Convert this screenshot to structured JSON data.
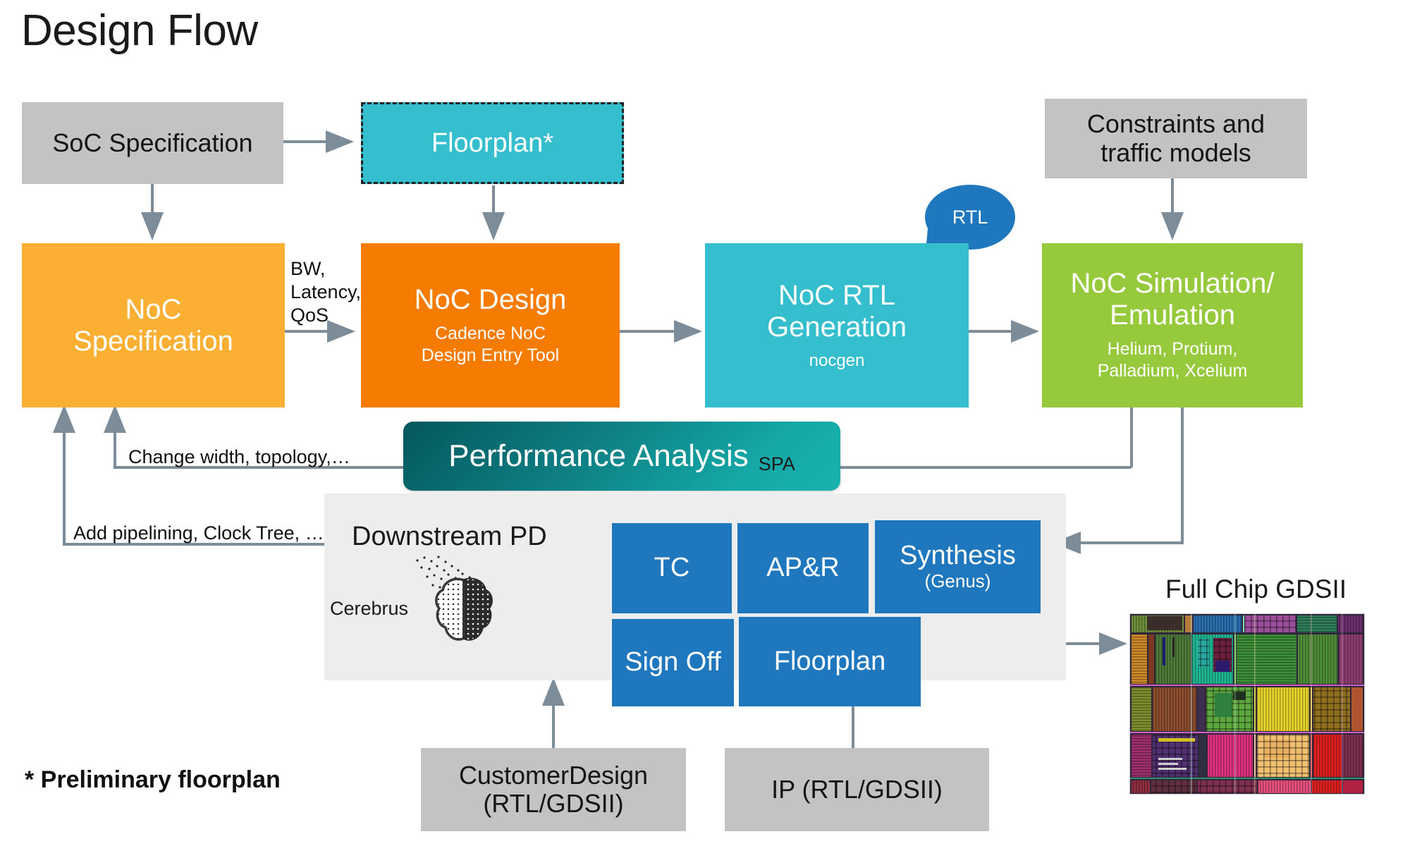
{
  "page": {
    "title": "Design Flow",
    "footnote": "* Preliminary floorplan"
  },
  "nodes": {
    "soc_spec": {
      "label": "SoC Specification"
    },
    "floorplan_prelim": {
      "label": "Floorplan*"
    },
    "constraints": {
      "line1": "Constraints and",
      "line2": "traffic models"
    },
    "noc_spec": {
      "line1": "NoC",
      "line2": "Specification"
    },
    "noc_design": {
      "title": "NoC Design",
      "sub_line1": "Cadence NoC",
      "sub_line2": "Design Entry Tool"
    },
    "noc_rtl_gen": {
      "line1": "NoC RTL",
      "line2": "Generation",
      "sub": "nocgen"
    },
    "noc_sim": {
      "line1": "NoC Simulation/",
      "line2": "Emulation",
      "sub_line1": "Helium, Protium,",
      "sub_line2": "Palladium, Xcelium"
    },
    "rtl_bubble": {
      "label": "RTL"
    }
  },
  "performance_analysis": {
    "title": "Performance Analysis",
    "sub": "SPA"
  },
  "downstream_pd": {
    "label": "Downstream PD",
    "cerebrus_label": "Cerebrus",
    "tiles": [
      {
        "label": "TC",
        "sub": ""
      },
      {
        "label": "AP&R",
        "sub": ""
      },
      {
        "label": "Synthesis",
        "sub": "(Genus)"
      },
      {
        "label": "Sign Off",
        "sub": ""
      },
      {
        "label": "Floorplan",
        "sub": ""
      }
    ]
  },
  "inputs": {
    "customer_design": {
      "line1": "CustomerDesign",
      "line2": "(RTL/GDSII)"
    },
    "ip": {
      "label": "IP (RTL/GDSII)"
    }
  },
  "output": {
    "gdsii_caption": "Full Chip GDSII"
  },
  "edge_labels": {
    "bw_latency_qos": "BW,\nLatency,\nQoS",
    "bw_line1": "BW,",
    "bw_line2": "Latency,",
    "bw_line3": "QoS",
    "change_width": "Change width, topology,…",
    "add_pipelining": "Add pipelining, Clock Tree, …"
  },
  "colors": {
    "gray_box": "#c3c3c3",
    "teal": "#35bfce",
    "amber": "#fbb033",
    "orange": "#f57c00",
    "green": "#97c93d",
    "blue_tile": "#1f77bd",
    "perf_dark": "#04575c",
    "perf_light": "#18b3ae",
    "panel_gray": "#ededed",
    "wire": "#7d8c99"
  }
}
